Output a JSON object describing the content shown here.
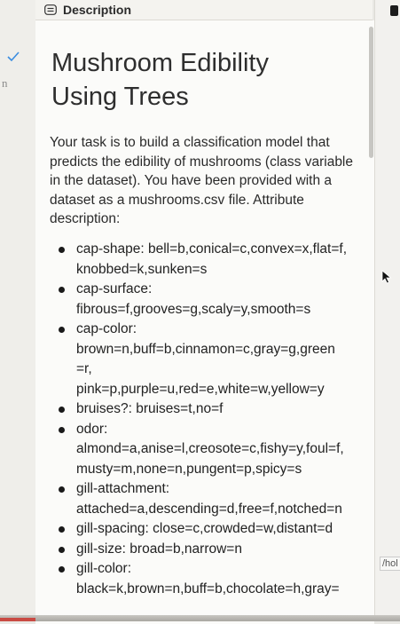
{
  "header": {
    "tab_label": "Description"
  },
  "left": {
    "letter": "n"
  },
  "right": {
    "path_text": "/hol"
  },
  "content": {
    "title_line1": "Mushroom Edibility",
    "title_line2": "Using Trees",
    "intro": "Your task is to build a classification model that predicts the edibility of mushrooms (class variable in the dataset). You have been provided with a dataset as a mushrooms.csv file. Attribute description:",
    "attributes": [
      [
        "cap-shape: bell=b,conical=c,convex=x,flat=f,",
        "knobbed=k,sunken=s"
      ],
      [
        "cap-surface:",
        "fibrous=f,grooves=g,scaly=y,smooth=s"
      ],
      [
        "cap-color:",
        "brown=n,buff=b,cinnamon=c,gray=g,green",
        "=r,",
        "pink=p,purple=u,red=e,white=w,yellow=y"
      ],
      [
        "bruises?: bruises=t,no=f"
      ],
      [
        "odor:",
        "almond=a,anise=l,creosote=c,fishy=y,foul=f,",
        "musty=m,none=n,pungent=p,spicy=s"
      ],
      [
        "gill-attachment:",
        "attached=a,descending=d,free=f,notched=n"
      ],
      [
        "gill-spacing: close=c,crowded=w,distant=d"
      ],
      [
        "gill-size: broad=b,narrow=n"
      ],
      [
        "gill-color:",
        "black=k,brown=n,buff=b,chocolate=h,gray="
      ]
    ]
  },
  "colors": {
    "check": "#3b8de0",
    "text": "#2a2a2a",
    "panel": "#fbfbf9"
  }
}
